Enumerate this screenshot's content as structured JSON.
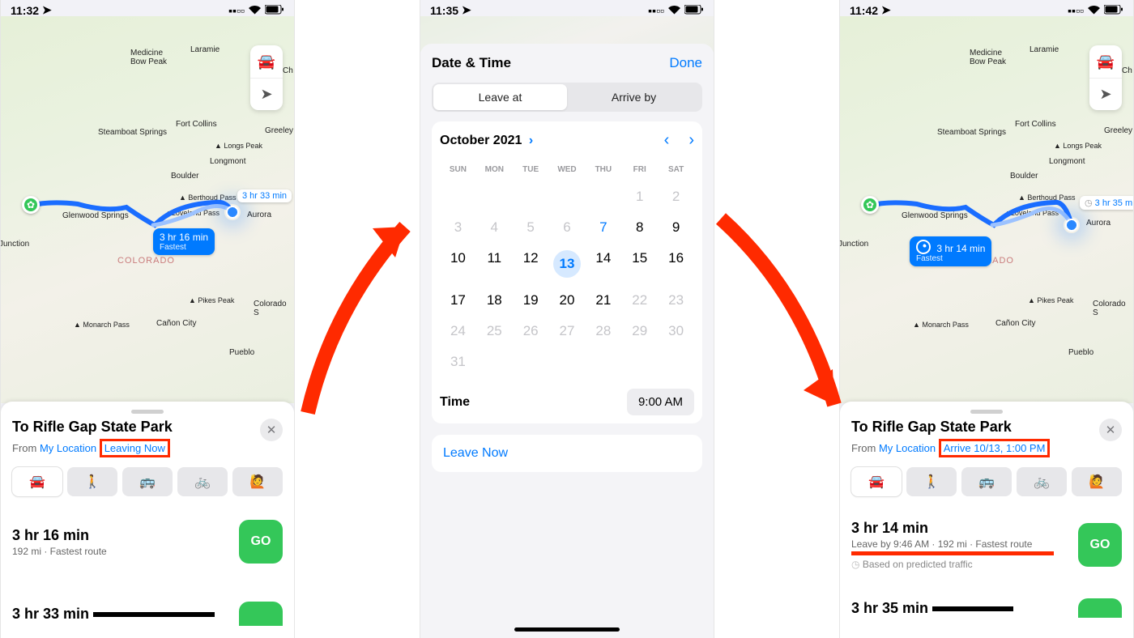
{
  "colors": {
    "accent": "#007aff",
    "go": "#34c759",
    "annotation": "#ff2a00"
  },
  "cities": [
    "Medicine Bow Peak",
    "Laramie",
    "Ch",
    "Steamboat Springs",
    "Fort Collins",
    "Greeley",
    "Boulder",
    "Longmont",
    "Glenwood Springs",
    "Loveland Pass",
    "Aurora",
    "Junction",
    "Colorado S",
    "Pikes Peak",
    "Monarch Pass",
    "Cañon City",
    "Pueblo",
    "Longs Peak",
    "Berthoud Pass"
  ],
  "state_label": "COLORADO",
  "phone1": {
    "time": "11:32",
    "callout_alt": "3 hr 33 min",
    "callout_main": "3 hr 16 min",
    "callout_sub": "Fastest",
    "title": "To Rifle Gap State Park",
    "from_label": "From",
    "from_link": "My Location",
    "timing_link": "Leaving Now",
    "routes": [
      {
        "duration": "3 hr 16 min",
        "detail": "192 mi · Fastest route",
        "go": "GO"
      },
      {
        "duration": "3 hr 33 min",
        "go": "GO"
      }
    ]
  },
  "phone2": {
    "time": "11:35",
    "sheet_title": "Date & Time",
    "done": "Done",
    "toggle": {
      "leave": "Leave at",
      "arrive": "Arrive by"
    },
    "month": "October 2021",
    "days": [
      "SUN",
      "MON",
      "TUE",
      "WED",
      "THU",
      "FRI",
      "SAT"
    ],
    "calendar": [
      [
        "",
        "",
        "",
        "",
        "",
        "1",
        "2"
      ],
      [
        "3",
        "4",
        "5",
        "6",
        "7",
        "8",
        "9"
      ],
      [
        "10",
        "11",
        "12",
        "13",
        "14",
        "15",
        "16"
      ],
      [
        "17",
        "18",
        "19",
        "20",
        "21",
        "22",
        "23"
      ],
      [
        "24",
        "25",
        "26",
        "27",
        "28",
        "29",
        "30"
      ],
      [
        "31",
        "",
        "",
        "",
        "",
        "",
        ""
      ]
    ],
    "gray_days": [
      "1",
      "2",
      "3",
      "4",
      "5",
      "6",
      "22",
      "23",
      "24",
      "25",
      "26",
      "27",
      "28",
      "29",
      "30",
      "31"
    ],
    "blue_days": [
      "7"
    ],
    "selected_day": "13",
    "time_label": "Time",
    "time_value": "9:00 AM",
    "leave_now": "Leave Now"
  },
  "phone3": {
    "time": "11:42",
    "callout_alt": "3 hr 35 m",
    "callout_main": "3 hr 14 min",
    "callout_sub": "Fastest",
    "title": "To Rifle Gap State Park",
    "from_label": "From",
    "from_link": "My Location",
    "timing_link": "Arrive 10/13, 1:00 PM",
    "routes": [
      {
        "duration": "3 hr 14 min",
        "detail": "Leave by 9:46 AM · 192 mi · Fastest route",
        "traffic": "Based on predicted traffic",
        "go": "GO"
      },
      {
        "duration": "3 hr 35 min",
        "go": "GO"
      }
    ]
  },
  "icons": {
    "transport": [
      "car",
      "walk",
      "transit",
      "bike",
      "rideshare"
    ]
  }
}
